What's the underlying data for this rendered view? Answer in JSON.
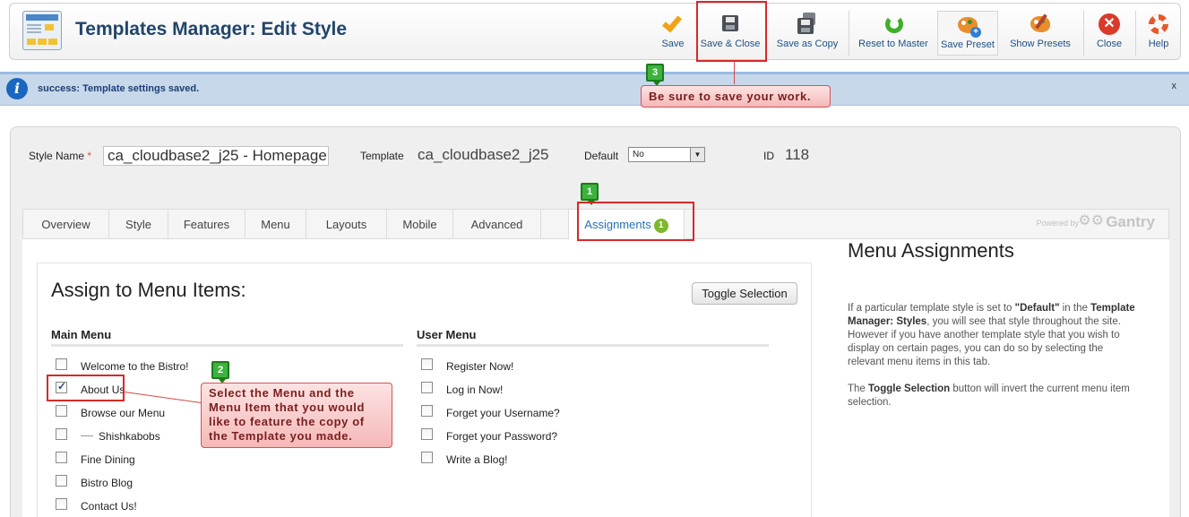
{
  "toolbar": {
    "title": "Templates Manager: Edit Style",
    "buttons": [
      {
        "label": "Save",
        "icon": "check-icon"
      },
      {
        "label": "Save & Close",
        "icon": "floppy-disk-icon"
      },
      {
        "label": "Save as Copy",
        "icon": "copy-disk-icon"
      },
      {
        "label": "Reset to Master",
        "icon": "refresh-icon"
      },
      {
        "label": "Save Preset",
        "icon": "palette-add-icon"
      },
      {
        "label": "Show Presets",
        "icon": "palette-brush-icon"
      },
      {
        "label": "Close",
        "icon": "close-icon"
      },
      {
        "label": "Help",
        "icon": "lifebuoy-icon"
      }
    ]
  },
  "message": {
    "text": "success: Template settings saved.",
    "close": "x"
  },
  "fields": {
    "style_name_label": "Style Name",
    "required_mark": "*",
    "style_name_value": "ca_cloudbase2_j25 - Homepage",
    "template_label": "Template",
    "template_value": "ca_cloudbase2_j25",
    "default_label": "Default",
    "default_value": "No",
    "id_label": "ID",
    "id_value": "118"
  },
  "tabs": [
    {
      "label": "Overview"
    },
    {
      "label": "Style"
    },
    {
      "label": "Features"
    },
    {
      "label": "Menu"
    },
    {
      "label": "Layouts"
    },
    {
      "label": "Mobile"
    },
    {
      "label": "Advanced"
    },
    {
      "label": "Assignments",
      "badge": "1"
    }
  ],
  "branding": {
    "powered_by": "Powered by",
    "name": "Gantry"
  },
  "assign": {
    "title": "Assign to Menu Items:",
    "toggle_label": "Toggle Selection",
    "main_menu": {
      "heading": "Main Menu",
      "items": [
        {
          "label": "Welcome to the Bistro!",
          "checked": false,
          "indent": false
        },
        {
          "label": "About Us",
          "checked": true,
          "indent": false
        },
        {
          "label": "Browse our Menu",
          "checked": false,
          "indent": false
        },
        {
          "label": "Shishkabobs",
          "checked": false,
          "indent": true
        },
        {
          "label": "Fine Dining",
          "checked": false,
          "indent": false
        },
        {
          "label": "Bistro Blog",
          "checked": false,
          "indent": false
        },
        {
          "label": "Contact Us!",
          "checked": false,
          "indent": false
        }
      ]
    },
    "user_menu": {
      "heading": "User Menu",
      "items": [
        {
          "label": "Register Now!",
          "checked": false
        },
        {
          "label": "Log in Now!",
          "checked": false
        },
        {
          "label": "Forget your Username?",
          "checked": false
        },
        {
          "label": "Forget your Password?",
          "checked": false
        },
        {
          "label": "Write a Blog!",
          "checked": false
        }
      ]
    }
  },
  "side": {
    "title": "Menu Assignments",
    "p1_a": "If a particular template style is set to ",
    "p1_b": "\"Default\"",
    "p1_c": " in the ",
    "p1_d": "Template Manager: Styles",
    "p1_e": ", you will see that style throughout the site. However if you have another template style that you wish to display on certain pages, you can do so by selecting the relevant menu items in this tab.",
    "p2_a": "The ",
    "p2_b": "Toggle Selection",
    "p2_c": " button will invert the current menu item selection."
  },
  "callouts": {
    "c1": {
      "num": "1"
    },
    "c2": {
      "num": "2",
      "text": "Select the Menu and the Menu Item that you would like to feature the copy of the Template you made."
    },
    "c3": {
      "num": "3",
      "text": "Be sure to save your work."
    }
  },
  "colors": {
    "accent": "#21456b",
    "success_badge": "#3db33d",
    "highlight": "#d82828",
    "message_bg": "#c7d8ea"
  }
}
